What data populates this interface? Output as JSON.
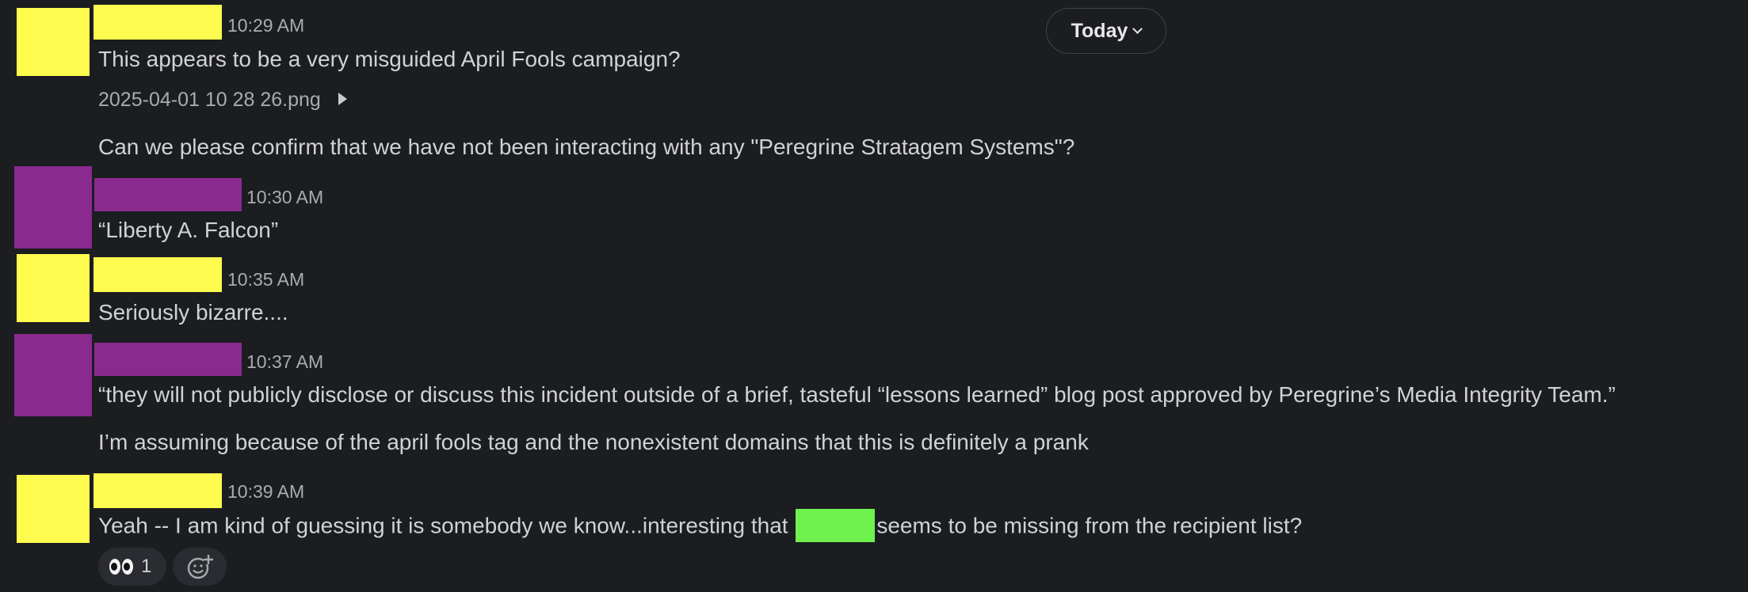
{
  "today_pill": {
    "label": "Today"
  },
  "messages": [
    {
      "timestamp": "10:29 AM",
      "lines": [
        "This appears to be a very misguided April Fools campaign?"
      ],
      "attachment": "2025-04-01 10 28 26.png",
      "followup": "Can we please confirm that we have not been interacting with any \"Peregrine Stratagem Systems\"?",
      "avatar_color": "#fdfb4d",
      "name_color": "#fdfb4d"
    },
    {
      "timestamp": "10:30 AM",
      "lines": [
        "“Liberty A. Falcon”"
      ],
      "avatar_color": "#8a2a8e",
      "name_color": "#8a2a8e"
    },
    {
      "timestamp": "10:35 AM",
      "lines": [
        "Seriously bizarre...."
      ],
      "avatar_color": "#fdfb4d",
      "name_color": "#fdfb4d"
    },
    {
      "timestamp": "10:37 AM",
      "lines": [
        "“they will not publicly disclose or discuss this incident outside of a brief, tasteful “lessons learned” blog post approved by Peregrine’s Media Integrity Team.”"
      ],
      "followup": "I’m assuming because of the april fools tag and the nonexistent domains that this is definitely a prank",
      "avatar_color": "#8a2a8e",
      "name_color": "#8a2a8e"
    },
    {
      "timestamp": "10:39 AM",
      "text_before": "Yeah -- I am kind of guessing it is somebody we know...interesting that",
      "text_after": "seems to be missing from the recipient list?",
      "redaction_color": "#6ff24d",
      "avatar_color": "#fdfb4d",
      "name_color": "#fdfb4d",
      "reactions": [
        {
          "emoji_icon": "eyes-emoji",
          "count": "1"
        }
      ]
    }
  ]
}
